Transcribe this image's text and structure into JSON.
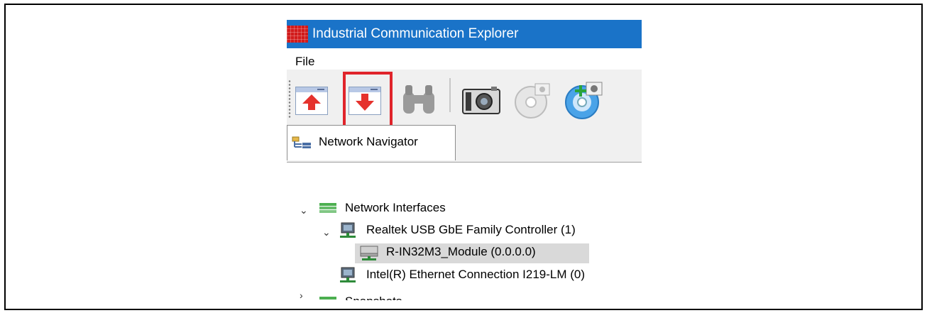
{
  "window": {
    "title": "Industrial Communication Explorer"
  },
  "menu": {
    "file": "File"
  },
  "toolbar": {
    "buttons": [
      {
        "name": "upload-button",
        "icon": "red-up-arrow-window-icon"
      },
      {
        "name": "download-button",
        "icon": "red-down-arrow-window-icon",
        "highlighted": true
      },
      {
        "name": "find-button",
        "icon": "binoculars-icon"
      },
      {
        "name": "snapshot-camera-button",
        "icon": "camera-icon"
      },
      {
        "name": "snapshot-disc-button",
        "icon": "disc-icon"
      },
      {
        "name": "add-snapshot-button",
        "icon": "disc-add-icon"
      }
    ],
    "highlight_color": "#e0242b"
  },
  "tabs": {
    "network_navigator": "Network Navigator"
  },
  "tree": {
    "network_interfaces": "Network Interfaces",
    "realtek": "Realtek USB GbE Family Controller (1)",
    "module": "R-IN32M3_Module (0.0.0.0)",
    "intel": "Intel(R) Ethernet Connection I219-LM (0)",
    "snapshots": "Snapshots"
  },
  "colors": {
    "titlebar": "#1a73c8",
    "selection": "#d9d9d9"
  }
}
